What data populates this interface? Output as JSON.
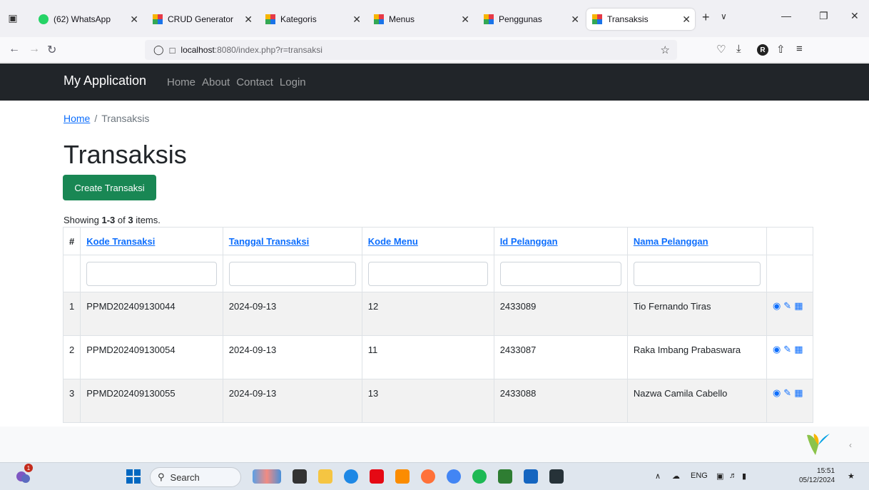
{
  "browser": {
    "tabs": [
      {
        "label": "(62) WhatsApp",
        "favicon": "whatsapp-icon",
        "active": false
      },
      {
        "label": "CRUD Generator",
        "favicon": "yii-icon",
        "active": false
      },
      {
        "label": "Kategoris",
        "favicon": "yii-icon",
        "active": false
      },
      {
        "label": "Menus",
        "favicon": "yii-icon",
        "active": false
      },
      {
        "label": "Penggunas",
        "favicon": "yii-icon",
        "active": false
      },
      {
        "label": "Transaksis",
        "favicon": "yii-icon",
        "active": true
      }
    ],
    "url_host": "localhost",
    "url_rest": ":8080/index.php?r=transaksi",
    "profile_initial": "R"
  },
  "navbar": {
    "brand": "My Application",
    "links": [
      "Home",
      "About",
      "Contact",
      "Login"
    ]
  },
  "breadcrumb": {
    "home": "Home",
    "separator": "/",
    "current": "Transaksis"
  },
  "page": {
    "title": "Transaksis",
    "create_button": "Create Transaksi",
    "summary_prefix": "Showing ",
    "summary_range": "1-3",
    "summary_mid": " of ",
    "summary_total": "3",
    "summary_suffix": " items."
  },
  "table": {
    "columns": [
      "#",
      "Kode Transaksi",
      "Tanggal Transaksi",
      "Kode Menu",
      "Id Pelanggan",
      "Nama Pelanggan"
    ],
    "rows": [
      {
        "n": "1",
        "kode": "PPMD202409130044",
        "tanggal": "2024-09-13",
        "menu": "12",
        "id": "2433089",
        "nama": "Tio Fernando Tiras"
      },
      {
        "n": "2",
        "kode": "PPMD202409130054",
        "tanggal": "2024-09-13",
        "menu": "11",
        "id": "2433087",
        "nama": "Raka Imbang Prabaswara"
      },
      {
        "n": "3",
        "kode": "PPMD202409130055",
        "tanggal": "2024-09-13",
        "menu": "13",
        "id": "2433088",
        "nama": "Nazwa Camila Cabello"
      }
    ]
  },
  "taskbar": {
    "search_label": "Search",
    "notification_count": "1",
    "language": "ENG",
    "time": "15:51",
    "date": "05/12/2024"
  },
  "colors": {
    "navbar_bg": "#212529",
    "link": "#0d6efd",
    "create_button": "#198754"
  }
}
